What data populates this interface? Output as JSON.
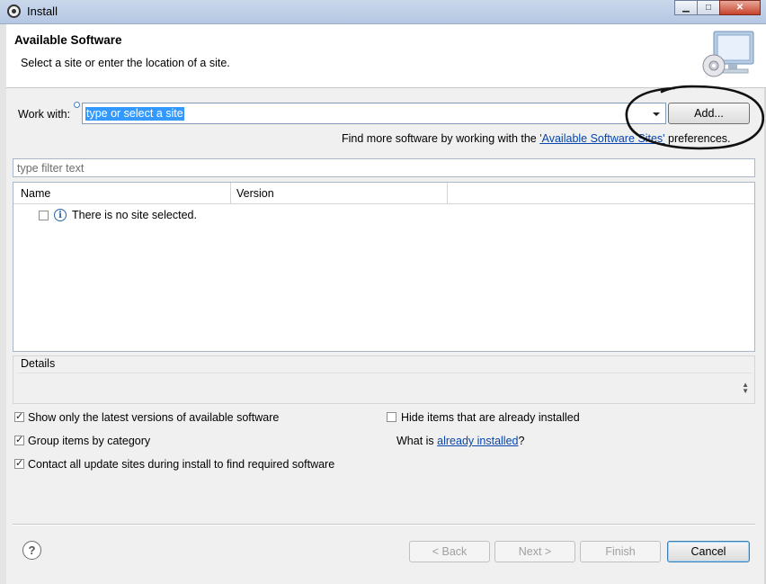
{
  "window": {
    "title": "Install",
    "minimize_icon": "minimize-icon",
    "maximize_icon": "maximize-icon",
    "close_icon": "close-icon"
  },
  "header": {
    "title": "Available Software",
    "description": "Select a site or enter the location of a site."
  },
  "work_with": {
    "label": "Work with:",
    "value": "type or select a site",
    "add_button": "Add...",
    "find_more_prefix": "Find more software by working with the ",
    "find_more_link": "'Available Software Sites'",
    "find_more_suffix": " preferences."
  },
  "filter": {
    "placeholder": "type filter text"
  },
  "table": {
    "columns": [
      "Name",
      "Version"
    ],
    "rows": [
      {
        "checked": false,
        "icon": "info-icon",
        "text": "There is no site selected."
      }
    ]
  },
  "details": {
    "label": "Details"
  },
  "options": {
    "show_latest": {
      "label": "Show only the latest versions of available software",
      "checked": true
    },
    "group_by_category": {
      "label": "Group items by category",
      "checked": true
    },
    "contact_all": {
      "label": "Contact all update sites during install to find required software",
      "checked": true
    },
    "hide_installed": {
      "label": "Hide items that are already installed",
      "checked": false
    },
    "what_is_prefix": "What is ",
    "what_is_link": "already installed",
    "what_is_suffix": "?"
  },
  "buttons": {
    "back": "< Back",
    "next": "Next >",
    "finish": "Finish",
    "cancel": "Cancel",
    "help_symbol": "?"
  }
}
